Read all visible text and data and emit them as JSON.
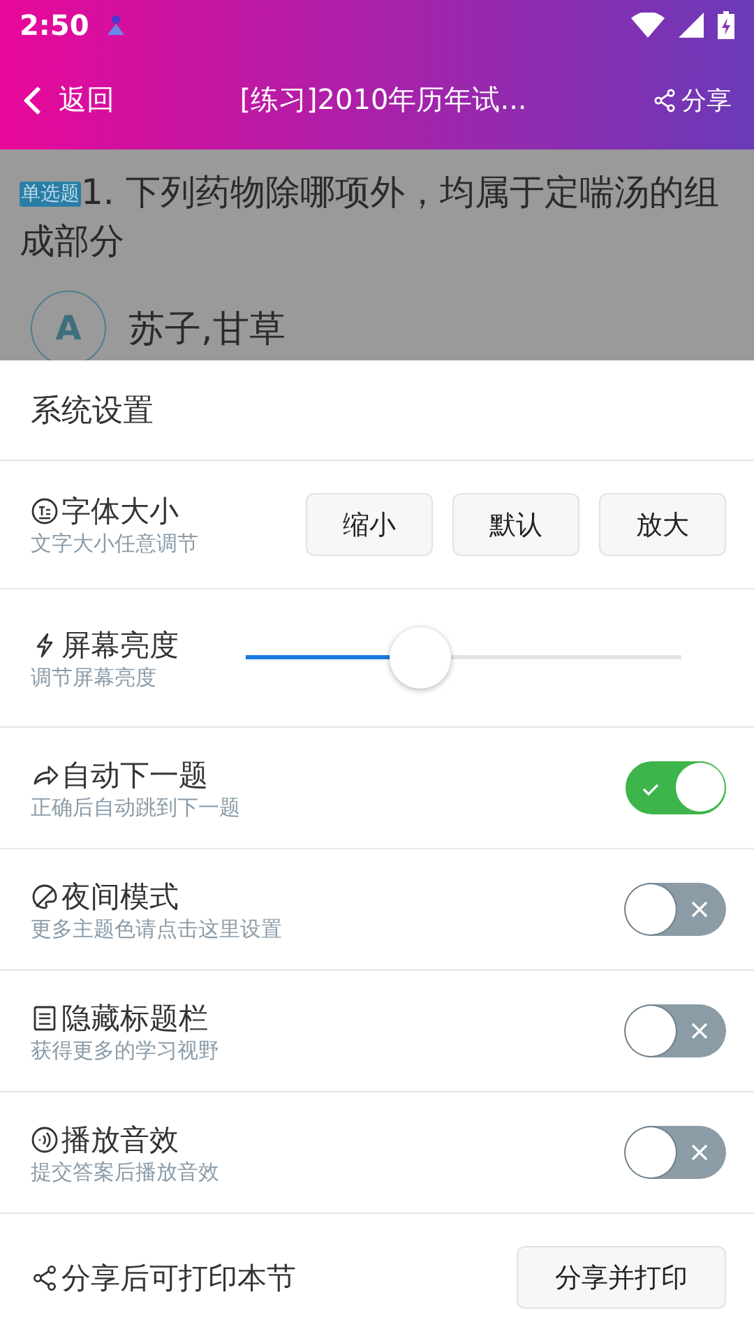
{
  "status_bar": {
    "time": "2:50"
  },
  "toolbar": {
    "back_label": "返回",
    "title": "[练习]2010年历年试...",
    "share_label": "分享"
  },
  "question": {
    "type_tag": "单选题",
    "text": "1. 下列药物除哪项外，均属于定喘汤的组成部分",
    "options": [
      {
        "letter": "A",
        "text": "苏子,甘草"
      }
    ]
  },
  "settings": {
    "title": "系统设置",
    "rows": [
      {
        "kind": "buttons",
        "title": "字体大小",
        "subtitle": "文字大小任意调节",
        "buttons": [
          "缩小",
          "默认",
          "放大"
        ]
      },
      {
        "kind": "slider",
        "title": "屏幕亮度",
        "subtitle": "调节屏幕亮度",
        "level": 0.4
      },
      {
        "kind": "toggle",
        "title": "自动下一题",
        "subtitle": "正确后自动跳到下一题",
        "on": true
      },
      {
        "kind": "toggle",
        "title": "夜间模式",
        "subtitle": "更多主题色请点击这里设置",
        "on": false
      },
      {
        "kind": "toggle",
        "title": "隐藏标题栏",
        "subtitle": "获得更多的学习视野",
        "on": false
      },
      {
        "kind": "toggle",
        "title": "播放音效",
        "subtitle": "提交答案后播放音效",
        "on": false
      },
      {
        "kind": "action",
        "title": "分享后可打印本节",
        "button": "分享并打印"
      }
    ]
  }
}
